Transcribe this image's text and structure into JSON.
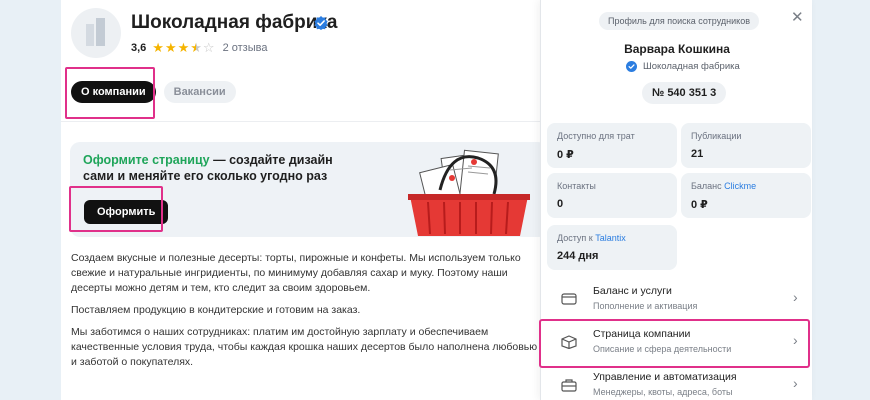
{
  "company": {
    "name": "Шоколадная фабрика",
    "rating": "3,6",
    "reviews": "2 отзыва"
  },
  "tabs": [
    {
      "label": "О компании",
      "active": true
    },
    {
      "label": "Вакансии",
      "active": false
    }
  ],
  "promo": {
    "accent": "Оформите страницу",
    "text": " — создайте дизайн сами и меняйте его сколько угодно раз",
    "button": "Оформить"
  },
  "description": [
    "Создаем вкусные и полезные десерты: торты, пирожные и конфеты. Мы используем только свежие и натуральные ингридиенты, по минимуму добавляя сахар и муку. Поэтому наши десерты можно детям и тем, кто следит за своим здоровьем.",
    "Поставляем продукцию в кондитерские и готовим на заказ.",
    "Мы заботимся о наших сотрудниках: платим им достойную зарплату и обеспечиваем качественные условия труда, чтобы каждая крошка наших десертов было наполнена любовью и заботой о покупателях."
  ],
  "panel": {
    "profile_label": "Профиль для поиска сотрудников",
    "user_name": "Варвара Кошкина",
    "user_company": "Шоколадная фабрика",
    "id_number": "№ 540 351 3",
    "stats": {
      "budget": {
        "label": "Доступно для трат",
        "value": "0 ₽"
      },
      "publications": {
        "label": "Публикации",
        "value": "21"
      },
      "contacts": {
        "label": "Контакты",
        "value": "0"
      },
      "clickme": {
        "label_prefix": "Баланс ",
        "label_brand": "Clickme",
        "value": "0 ₽"
      },
      "talantix": {
        "label_prefix": "Доступ к ",
        "label_brand": "Talantix",
        "value": "244 дня"
      }
    },
    "menu": [
      {
        "title": "Баланс и услуги",
        "subtitle": "Пополнение и активация",
        "icon": "wallet-icon"
      },
      {
        "title": "Страница компании",
        "subtitle": "Описание и сфера деятельности",
        "icon": "box-icon"
      },
      {
        "title": "Управление и автоматизация",
        "subtitle": "Менеджеры, квоты, адреса, боты",
        "icon": "briefcase-icon"
      }
    ]
  },
  "colors": {
    "accent_green": "#1fa55a",
    "highlight_pink": "#e0308a",
    "brand_blue": "#2b7de0",
    "star_gold": "#f5b400"
  }
}
